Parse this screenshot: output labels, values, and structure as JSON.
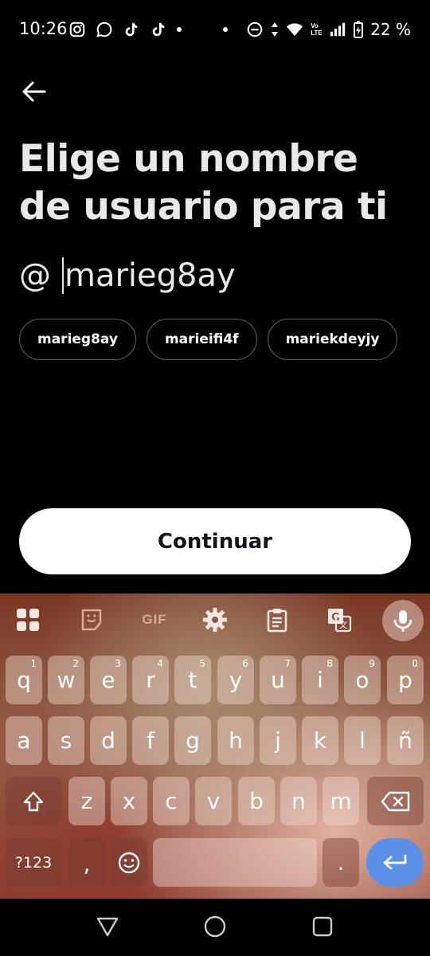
{
  "status_bar": {
    "time": "10:26",
    "battery": "22 %",
    "icons_left": [
      "instagram-icon",
      "chat-icon",
      "tiktok-icon",
      "tiktok-icon",
      "dot"
    ],
    "icons_right": [
      "dot",
      "do-not-disturb-icon",
      "data-arrows-icon",
      "wifi-icon",
      "volte-icon",
      "signal-icon",
      "battery-charging-icon"
    ],
    "volte_label": "Vo LTE"
  },
  "header": {
    "back_icon": "back-arrow-icon",
    "title": "Elige un nombre de usuario para ti"
  },
  "username": {
    "prefix": "@",
    "value": "marieg8ay"
  },
  "suggestions": [
    "marieg8ay",
    "marieifi4f",
    "mariekdeyjy"
  ],
  "continue_label": "Continuar",
  "keyboard": {
    "toolbar": [
      "apps-icon",
      "sticker-icon",
      "gif-icon",
      "settings-icon",
      "clipboard-icon",
      "translate-icon",
      "mic-icon"
    ],
    "gif_label": "GIF",
    "row1": [
      {
        "k": "q",
        "h": "1"
      },
      {
        "k": "w",
        "h": "2"
      },
      {
        "k": "e",
        "h": "3"
      },
      {
        "k": "r",
        "h": "4"
      },
      {
        "k": "t",
        "h": "5"
      },
      {
        "k": "y",
        "h": "6"
      },
      {
        "k": "u",
        "h": "7"
      },
      {
        "k": "i",
        "h": "8"
      },
      {
        "k": "o",
        "h": "9"
      },
      {
        "k": "p",
        "h": "0"
      }
    ],
    "row2": [
      "a",
      "s",
      "d",
      "f",
      "g",
      "h",
      "j",
      "k",
      "l",
      "ñ"
    ],
    "row3": [
      "z",
      "x",
      "c",
      "v",
      "b",
      "n",
      "m"
    ],
    "symbols_label": "?123",
    "comma": ",",
    "period": "."
  },
  "colors": {
    "background": "#000000",
    "text": "#e7e9ea",
    "chip_border": "#536471",
    "button_bg": "#ffffff",
    "enter_key": "#5b8fe8"
  }
}
